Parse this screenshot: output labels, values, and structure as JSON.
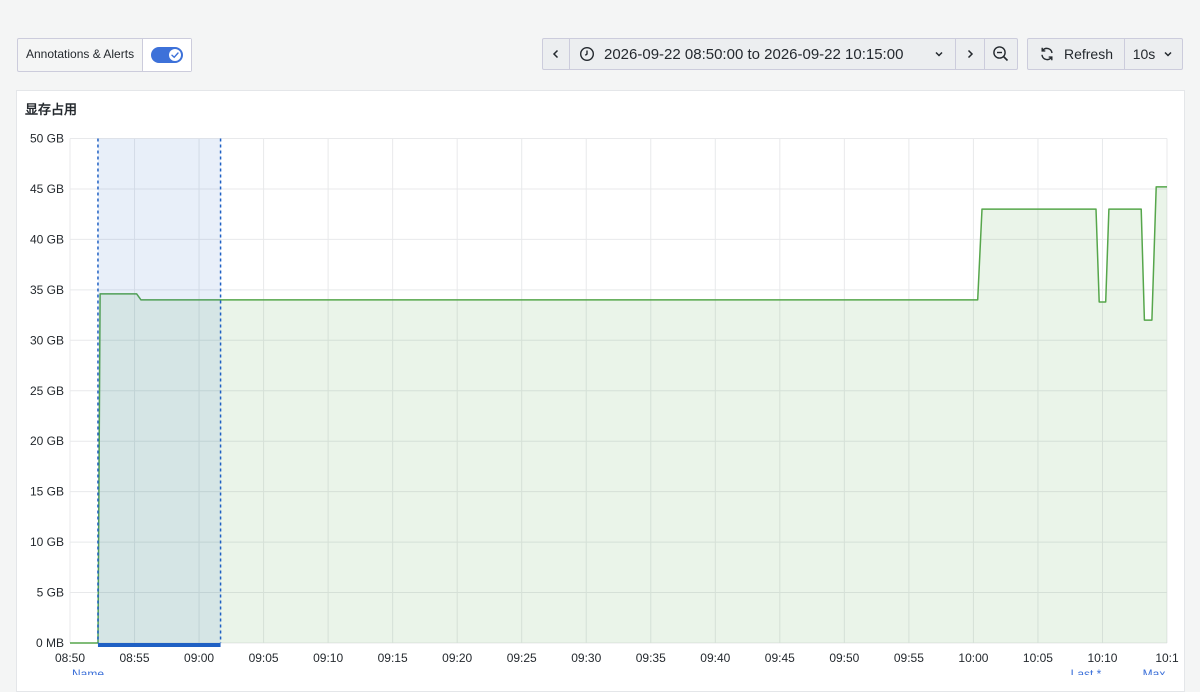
{
  "toolbar": {
    "annotations_label": "Annotations & Alerts",
    "annotations_enabled": true,
    "time_range": "2026-09-22 08:50:00 to 2026-09-22 10:15:00",
    "refresh_label": "Refresh",
    "refresh_interval": "10s"
  },
  "panel": {
    "title": "显存占用"
  },
  "legend_headers": [
    "Name",
    "Last *",
    "Max"
  ],
  "colors": {
    "series": "#56a64b",
    "annotation": "#1f60c4",
    "accent": "#3d71d9"
  },
  "chart_data": {
    "type": "area",
    "title": "显存占用",
    "xlabel": "",
    "ylabel": "",
    "y_ticks": [
      "0 MB",
      "5 GB",
      "10 GB",
      "15 GB",
      "20 GB",
      "25 GB",
      "30 GB",
      "35 GB",
      "40 GB",
      "45 GB",
      "50 GB"
    ],
    "ylim_gb": [
      0,
      50
    ],
    "x_ticks": [
      "08:50",
      "08:55",
      "09:00",
      "09:05",
      "09:10",
      "09:15",
      "09:20",
      "09:25",
      "09:30",
      "09:35",
      "09:40",
      "09:45",
      "09:50",
      "09:55",
      "10:00",
      "10:05",
      "10:10",
      "10:1"
    ],
    "xlim": [
      "08:50",
      "10:15"
    ],
    "grid": true,
    "annotation_region": {
      "from": "08:52:10",
      "to": "09:01:40"
    },
    "series": [
      {
        "points_gb": [
          [
            "08:50:00",
            0
          ],
          [
            "08:52:10",
            0
          ],
          [
            "08:52:20",
            34.6
          ],
          [
            "08:55:10",
            34.6
          ],
          [
            "08:55:30",
            34.0
          ],
          [
            "10:00:20",
            34.0
          ],
          [
            "10:00:40",
            43.0
          ],
          [
            "10:09:30",
            43.0
          ],
          [
            "10:09:45",
            33.8
          ],
          [
            "10:10:15",
            33.8
          ],
          [
            "10:10:30",
            43.0
          ],
          [
            "10:13:00",
            43.0
          ],
          [
            "10:13:15",
            32.0
          ],
          [
            "10:13:50",
            32.0
          ],
          [
            "10:14:10",
            45.2
          ],
          [
            "10:15:00",
            45.2
          ]
        ]
      }
    ]
  }
}
